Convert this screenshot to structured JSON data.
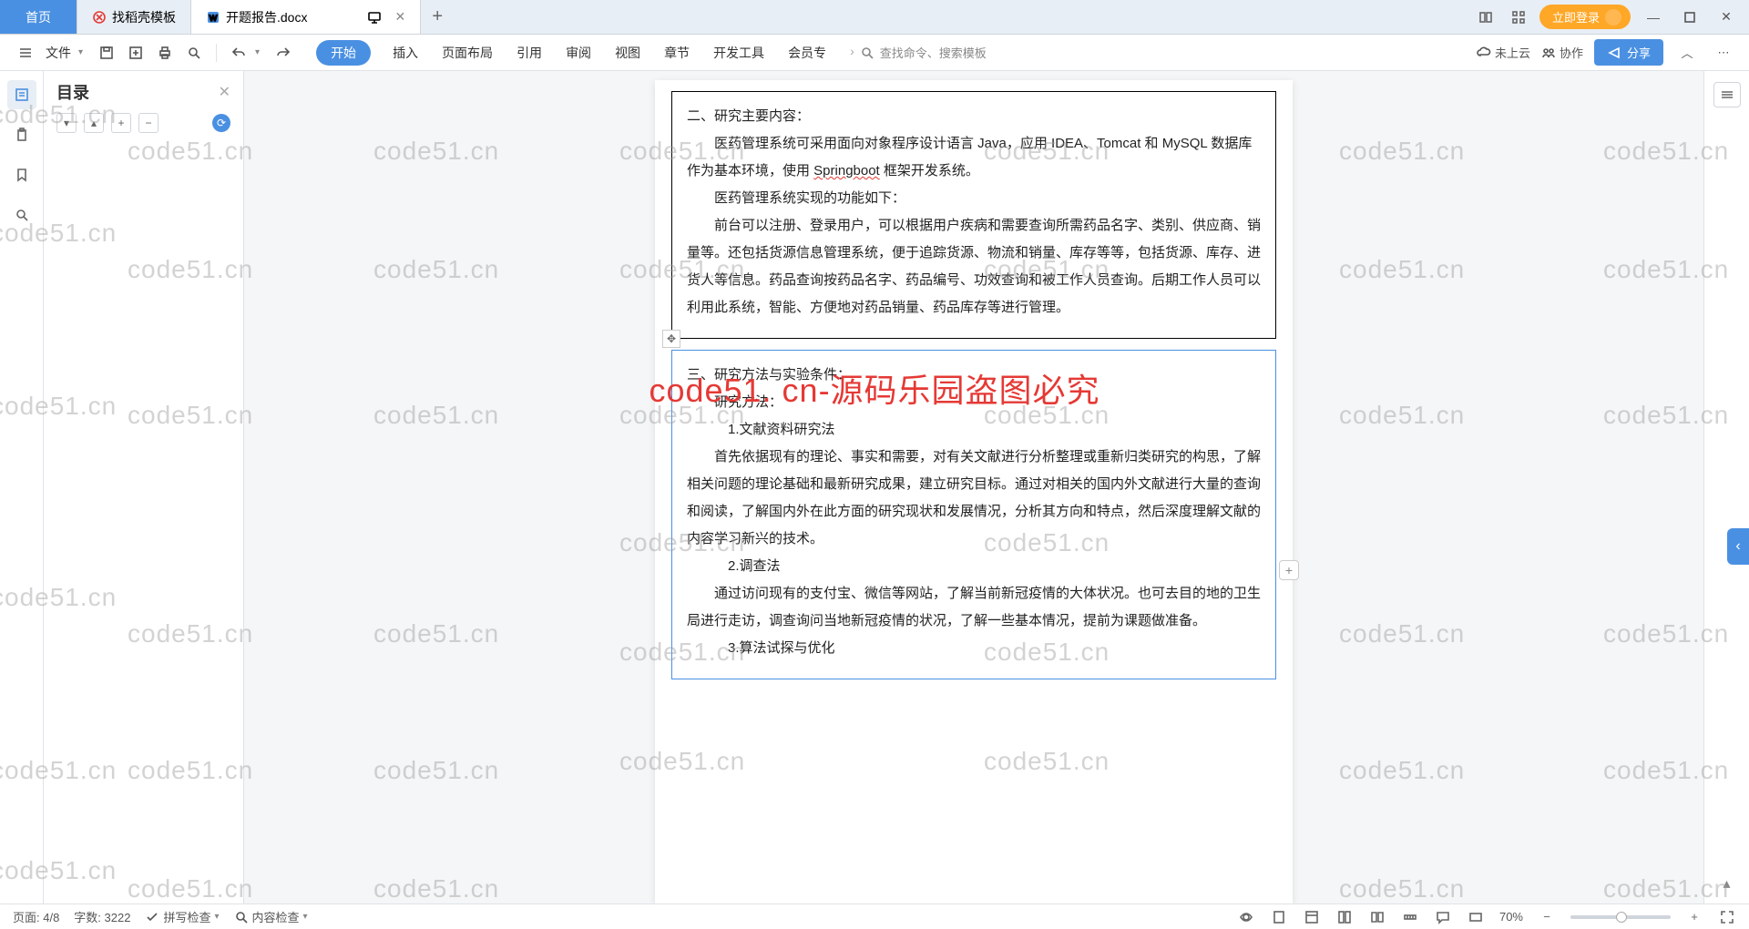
{
  "titlebar": {
    "home": "首页",
    "tab_template": "找稻壳模板",
    "tab_doc": "开题报告.docx",
    "login": "立即登录"
  },
  "menubar": {
    "file": "文件",
    "items": [
      "开始",
      "插入",
      "页面布局",
      "引用",
      "审阅",
      "视图",
      "章节",
      "开发工具",
      "会员专"
    ],
    "search": "查找命令、搜索模板",
    "cloud": "未上云",
    "collab": "协作",
    "share": "分享"
  },
  "toc": {
    "title": "目录"
  },
  "doc": {
    "sec2_title": "二、研究主要内容：",
    "sec2_p1a": "医药管理系统可采用面向对象程序设计语言 Java，应用 IDEA、Tomcat 和 MySQL 数据库作为基本环境，使用 ",
    "sec2_p1_err": "Springboot",
    "sec2_p1b": " 框架开发系统。",
    "sec2_p2": "医药管理系统实现的功能如下：",
    "sec2_p3": "前台可以注册、登录用户，可以根据用户疾病和需要查询所需药品名字、类别、供应商、销量等。还包括货源信息管理系统，便于追踪货源、物流和销量、库存等等，包括货源、库存、进货人等信息。药品查询按药品名字、药品编号、功效查询和被工作人员查询。后期工作人员可以利用此系统，智能、方便地对药品销量、药品库存等进行管理。",
    "sec3_title": "三、研究方法与实验条件：",
    "sec3_h1": "研究方法：",
    "sec3_m1": "1.文献资料研究法",
    "sec3_m1_p": "首先依据现有的理论、事实和需要，对有关文献进行分析整理或重新归类研究的构思，了解相关问题的理论基础和最新研究成果，建立研究目标。通过对相关的国内外文献进行大量的查询和阅读，了解国内外在此方面的研究现状和发展情况，分析其方向和特点，然后深度理解文献的内容学习新兴的技术。",
    "sec3_m2": "2.调查法",
    "sec3_m2_p": "通过访问现有的支付宝、微信等网站，了解当前新冠疫情的大体状况。也可去目的地的卫生局进行走访，调查询问当地新冠疫情的状况，了解一些基本情况，提前为课题做准备。",
    "sec3_m3": "3.算法试探与优化"
  },
  "watermark": {
    "text": "code51.cn",
    "banner": "code51. cn-源码乐园盗图必究"
  },
  "status": {
    "page": "页面: 4/8",
    "words": "字数: 3222",
    "spell": "拼写检查",
    "content": "内容检查",
    "zoom": "70%"
  }
}
